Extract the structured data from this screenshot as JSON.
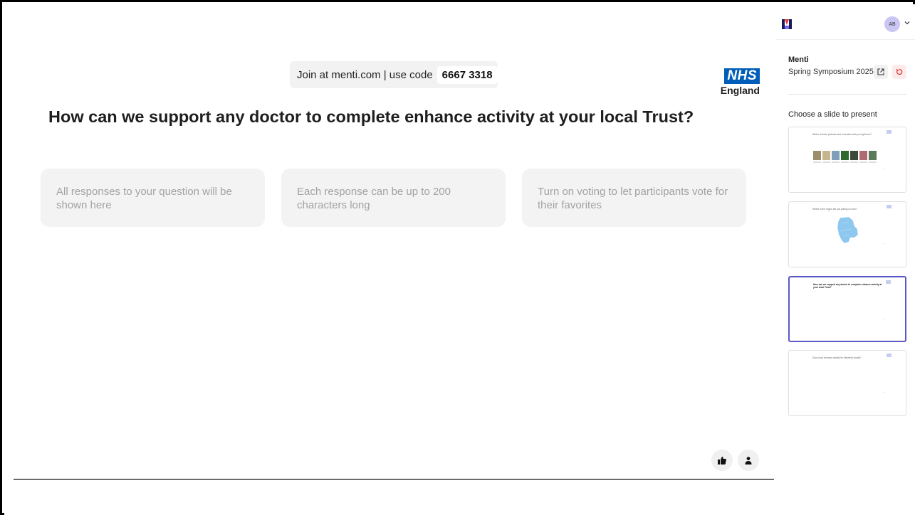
{
  "slide": {
    "join_text": "Join at menti.com | use code",
    "join_code": "6667 3318",
    "logo_nhs": "NHS",
    "logo_sub": "England",
    "question": "How can we support any doctor to complete enhance activity at your local Trust?",
    "cards": [
      "All responses to your question will be shown here",
      "Each response can be up to 200 characters long",
      "Turn on voting to let participants vote for their favorites"
    ],
    "buttons": {
      "reactions_icon": "thumbs-up-icon",
      "participants_icon": "person-icon"
    }
  },
  "sidebar": {
    "avatar_initials": "AB",
    "org": "Menti",
    "event": "Spring Symposium 2025",
    "choose_label": "Choose a slide to present",
    "thumbnails": [
      {
        "title": "Which of these pictures best resonates with you right now?",
        "selected": false
      },
      {
        "title": "Where in the region are you joining us from?",
        "selected": false
      },
      {
        "title": "How can we support any doctor to complete enhance activity at your local Trust?",
        "selected": true
      },
      {
        "title": "Does local enhance activity be delivered locally?",
        "selected": false
      }
    ]
  },
  "colors": {
    "nhs_blue": "#005eb8",
    "selected_border": "#5a58c8",
    "card_bg": "#f3f3f3",
    "avatar_bg": "#c9c6f3"
  }
}
